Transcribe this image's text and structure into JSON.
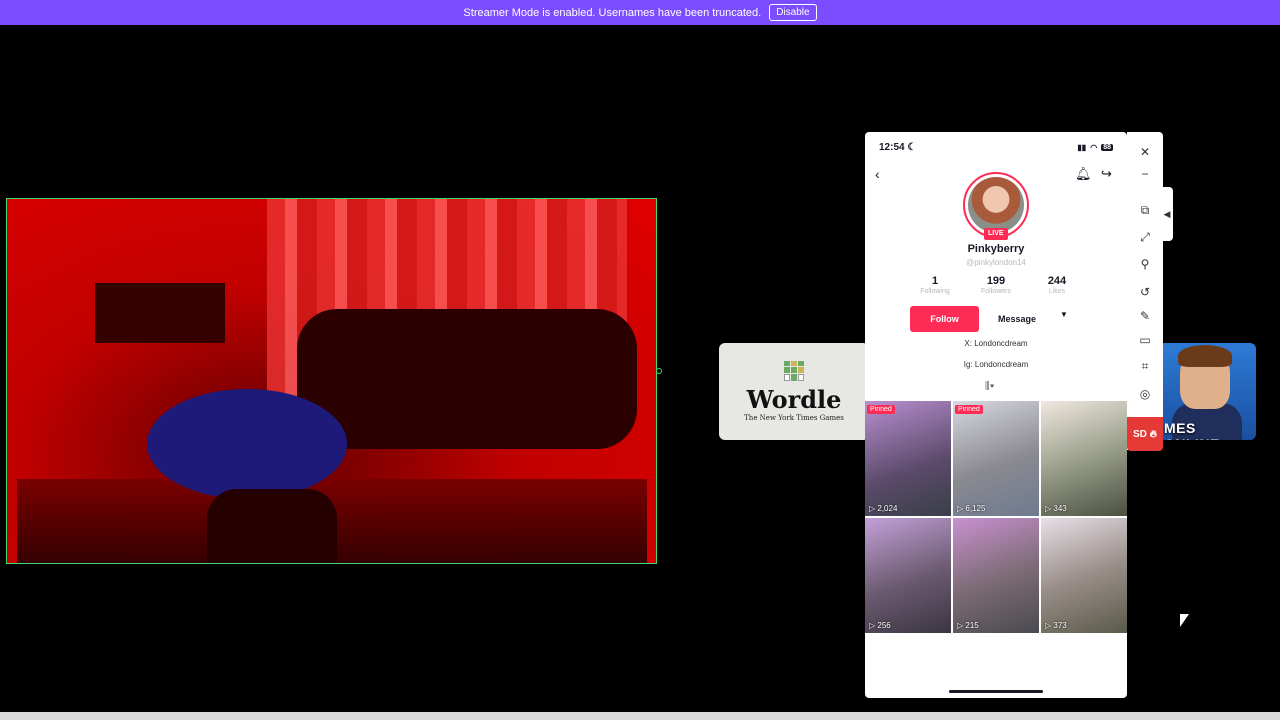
{
  "banner": {
    "message": "Streamer Mode is enabled. Usernames have been truncated.",
    "button_label": "Disable",
    "color": "#7c4dff"
  },
  "cards": {
    "wordle": {
      "title": "Wordle",
      "subtitle": "The New York Times Games"
    },
    "game": {
      "label": "MES ONLINE"
    }
  },
  "phone": {
    "status": {
      "time": "12:54",
      "moon_icon": "moon-icon",
      "battery": "88"
    },
    "profile": {
      "live_label": "LIVE",
      "display_name": "Pinkyberry",
      "username": "@pinkylondon14",
      "stats": [
        {
          "value": "1",
          "label": "Following"
        },
        {
          "value": "199",
          "label": "Followers"
        },
        {
          "value": "244",
          "label": "Likes"
        }
      ],
      "follow_label": "Follow",
      "message_label": "Message",
      "bio": [
        "X: Londoncdream",
        "Ig: Londoncdream"
      ],
      "accent": "#fe2c55"
    },
    "videos": [
      {
        "pinned": "Pinned",
        "views": "2,024"
      },
      {
        "pinned": "Pinned",
        "views": "6,125"
      },
      {
        "pinned": "",
        "views": "343"
      },
      {
        "pinned": "",
        "views": "256"
      },
      {
        "pinned": "",
        "views": "215"
      },
      {
        "pinned": "",
        "views": "373"
      }
    ]
  },
  "rail": {
    "sd_label": "SD",
    "icons": [
      "close-icon",
      "minimize-icon",
      "screen-icon",
      "fullscreen-icon",
      "pin-icon",
      "rotate-icon",
      "pen-icon",
      "split-icon",
      "crop-icon",
      "target-icon"
    ]
  }
}
